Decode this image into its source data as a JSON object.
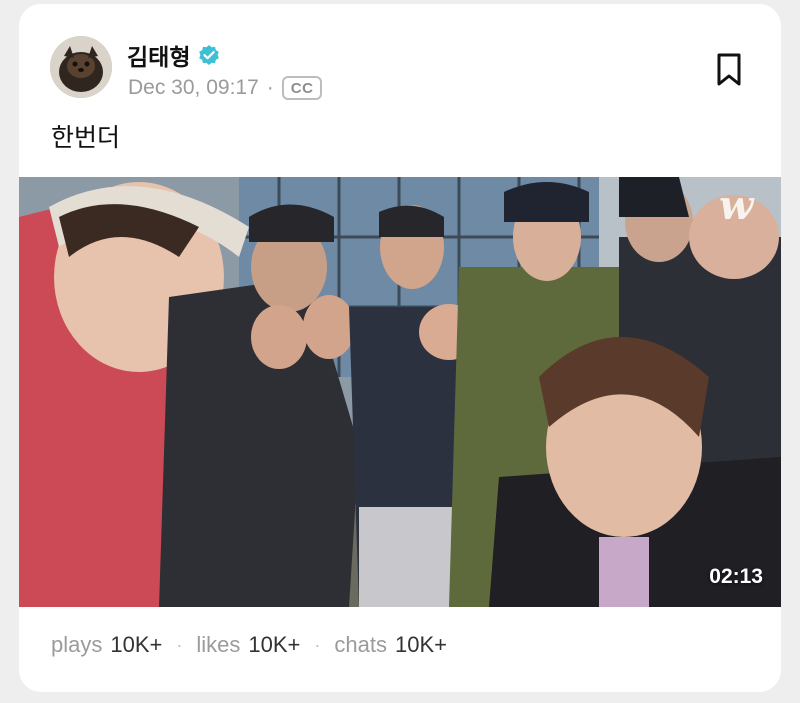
{
  "post": {
    "author": "김태형",
    "date": "Dec 30, 09:17",
    "separator": "·",
    "cc_label": "CC",
    "text": "한번더"
  },
  "video": {
    "duration": "02:13",
    "watermark_glyph": "w"
  },
  "stats": {
    "plays_label": "plays",
    "plays_value": "10K+",
    "likes_label": "likes",
    "likes_value": "10K+",
    "chats_label": "chats",
    "chats_value": "10K+",
    "dot": "·"
  },
  "icons": {
    "verified": "verified-check-icon",
    "bookmark": "bookmark-icon"
  },
  "colors": {
    "verified": "#3cc0d6",
    "text_primary": "#111111",
    "text_muted": "#9a9a9a"
  }
}
